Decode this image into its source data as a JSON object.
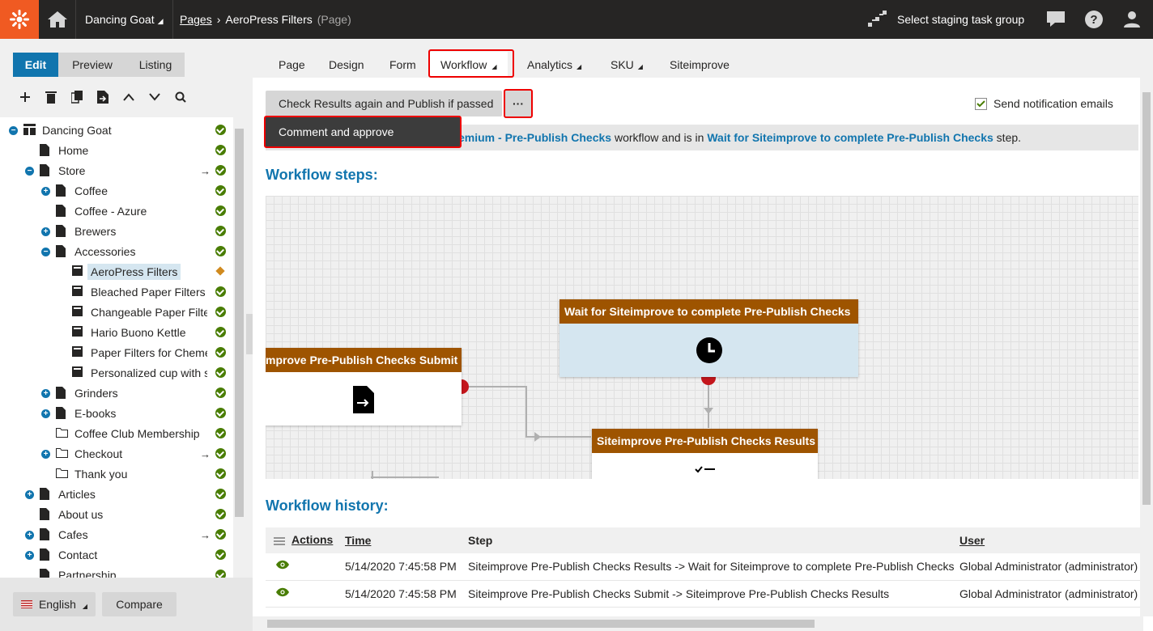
{
  "header": {
    "site_name": "Dancing Goat",
    "crumb_pages": "Pages",
    "crumb_current": "AeroPress Filters",
    "crumb_type": "(Page)",
    "staging_label": "Select staging task group"
  },
  "modes": {
    "edit": "Edit",
    "preview": "Preview",
    "listing": "Listing"
  },
  "tree": [
    {
      "label": "Dancing Goat",
      "toggle": "−",
      "status": "published",
      "arrow": ""
    },
    {
      "label": "Home",
      "toggle": "",
      "status": "published",
      "arrow": ""
    },
    {
      "label": "Store",
      "toggle": "−",
      "status": "published",
      "arrow": "→"
    },
    {
      "label": "Coffee",
      "toggle": "+",
      "status": "published",
      "arrow": ""
    },
    {
      "label": "Coffee - Azure",
      "toggle": "",
      "status": "published",
      "arrow": ""
    },
    {
      "label": "Brewers",
      "toggle": "+",
      "status": "published",
      "arrow": ""
    },
    {
      "label": "Accessories",
      "toggle": "−",
      "status": "published",
      "arrow": ""
    },
    {
      "label": "AeroPress Filters",
      "toggle": "",
      "status": "edited",
      "arrow": ""
    },
    {
      "label": "Bleached Paper Filters V",
      "toggle": "",
      "status": "published",
      "arrow": ""
    },
    {
      "label": "Changeable Paper Filter",
      "toggle": "",
      "status": "published",
      "arrow": ""
    },
    {
      "label": "Hario Buono Kettle",
      "toggle": "",
      "status": "published",
      "arrow": ""
    },
    {
      "label": "Paper Filters for Chemex",
      "toggle": "",
      "status": "published",
      "arrow": ""
    },
    {
      "label": "Personalized cup with sa",
      "toggle": "",
      "status": "published",
      "arrow": ""
    },
    {
      "label": "Grinders",
      "toggle": "+",
      "status": "published",
      "arrow": ""
    },
    {
      "label": "E-books",
      "toggle": "+",
      "status": "published",
      "arrow": ""
    },
    {
      "label": "Coffee Club Membership",
      "toggle": "",
      "status": "published",
      "arrow": ""
    },
    {
      "label": "Checkout",
      "toggle": "+",
      "status": "published",
      "arrow": "→"
    },
    {
      "label": "Thank you",
      "toggle": "",
      "status": "published",
      "arrow": ""
    },
    {
      "label": "Articles",
      "toggle": "+",
      "status": "published",
      "arrow": ""
    },
    {
      "label": "About us",
      "toggle": "",
      "status": "published",
      "arrow": ""
    },
    {
      "label": "Cafes",
      "toggle": "+",
      "status": "published",
      "arrow": "→"
    },
    {
      "label": "Contact",
      "toggle": "+",
      "status": "published",
      "arrow": ""
    },
    {
      "label": "Partnership",
      "toggle": "",
      "status": "published",
      "arrow": ""
    }
  ],
  "footer": {
    "language": "English",
    "compare": "Compare"
  },
  "tabs": {
    "page": "Page",
    "design": "Design",
    "form": "Form",
    "workflow": "Workflow",
    "analytics": "Analytics",
    "sku": "SKU",
    "siteimprove": "Siteimprove"
  },
  "actions": {
    "primary": "Check Results again and Publish if passed",
    "more": "···",
    "dropdown_item": "Comment and approve",
    "notify": "Send notification emails",
    "notify_checked": true
  },
  "info": {
    "wf_name": "emium - Pre-Publish Checks",
    "mid": " workflow and is in ",
    "step_name": "Wait for Siteimprove to complete Pre-Publish Checks",
    "end": " step."
  },
  "steps_title": "Workflow steps:",
  "diagram": {
    "node_wait": "Wait for Siteimprove to complete Pre-Publish Checks",
    "node_submit": "mprove Pre-Publish Checks Submit",
    "node_results": "Siteimprove Pre-Publish Checks Results"
  },
  "history_title": "Workflow history:",
  "history": {
    "columns": {
      "actions": "Actions",
      "time": "Time",
      "step": "Step",
      "user": "User"
    },
    "rows": [
      {
        "time": "5/14/2020 7:45:58 PM",
        "step": "Siteimprove Pre-Publish Checks Results -> Wait for Siteimprove to complete Pre-Publish Checks",
        "user": "Global Administrator (administrator)"
      },
      {
        "time": "5/14/2020 7:45:58 PM",
        "step": "Siteimprove Pre-Publish Checks Submit -> Siteimprove Pre-Publish Checks Results",
        "user": "Global Administrator (administrator)"
      }
    ]
  }
}
